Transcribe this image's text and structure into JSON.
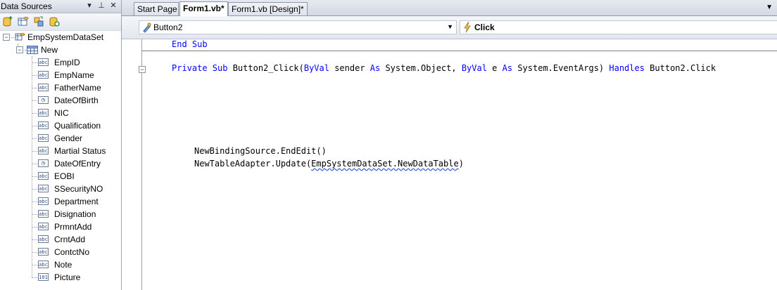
{
  "data_sources": {
    "title": "Data Sources",
    "controls": {
      "dropdown": "▾",
      "pin": "⊥",
      "close": "✕"
    },
    "toolbar_icons": [
      "add-data-source-icon",
      "edit-dataset-icon",
      "configure-icon",
      "refresh-icon"
    ],
    "root": {
      "label": "EmpSystemDataSet",
      "expander": "−"
    },
    "table": {
      "label": "New",
      "expander": "−"
    },
    "fields": [
      {
        "label": "EmpID",
        "icon": "abc"
      },
      {
        "label": "EmpName",
        "icon": "abc"
      },
      {
        "label": "FatherName",
        "icon": "abc"
      },
      {
        "label": "DateOfBirth",
        "icon": "clock"
      },
      {
        "label": "NIC",
        "icon": "abc"
      },
      {
        "label": "Qualification",
        "icon": "abc"
      },
      {
        "label": "Gender",
        "icon": "abc"
      },
      {
        "label": "Martial Status",
        "icon": "abc"
      },
      {
        "label": "DateOfEntry",
        "icon": "clock"
      },
      {
        "label": "EOBI",
        "icon": "abc"
      },
      {
        "label": "SSecurityNO",
        "icon": "abc"
      },
      {
        "label": "Department",
        "icon": "abc"
      },
      {
        "label": "Disignation",
        "icon": "abc"
      },
      {
        "label": "PrmntAdd",
        "icon": "abc"
      },
      {
        "label": "CrntAdd",
        "icon": "abc"
      },
      {
        "label": "ContctNo",
        "icon": "abc"
      },
      {
        "label": "Note",
        "icon": "abc"
      },
      {
        "label": "Picture",
        "icon": "picture"
      }
    ],
    "icon_glyphs": {
      "abc": "abc",
      "clock": "◷",
      "picture": "101"
    }
  },
  "tabs": {
    "items": [
      {
        "label": "Start Page",
        "active": false
      },
      {
        "label": "Form1.vb*",
        "active": true
      },
      {
        "label": "Form1.vb [Design]*",
        "active": false
      }
    ],
    "menu_glyph": "▼"
  },
  "nav": {
    "object": "Button2",
    "event": "Click",
    "arrow": "▼"
  },
  "code": {
    "outline_glyph": "−",
    "lines": [
      [
        {
          "t": "End Sub",
          "kw": true
        }
      ],
      [
        {
          "t": "Private Sub",
          "kw": true
        },
        {
          "t": " Button2_Click(",
          "kw": false
        },
        {
          "t": "ByVal",
          "kw": true
        },
        {
          "t": " sender ",
          "kw": false
        },
        {
          "t": "As",
          "kw": true
        },
        {
          "t": " System.Object, ",
          "kw": false
        },
        {
          "t": "ByVal",
          "kw": true
        },
        {
          "t": " e ",
          "kw": false
        },
        {
          "t": "As",
          "kw": true
        },
        {
          "t": " System.EventArgs) ",
          "kw": false
        },
        {
          "t": "Handles",
          "kw": true
        },
        {
          "t": " Button2.Click",
          "kw": false
        }
      ],
      [
        {
          "t": "NewBindingSource.EndEdit()",
          "kw": false
        }
      ],
      [
        {
          "t": "NewTableAdapter.Update(",
          "kw": false
        },
        {
          "t": "EmpSystemDataSet.NewDataTable",
          "kw": false,
          "squiggle": true
        },
        {
          "t": ")",
          "kw": false
        }
      ]
    ]
  },
  "colors": {
    "keyword": "#0000ff",
    "squiggle": "#3a5fd4"
  }
}
